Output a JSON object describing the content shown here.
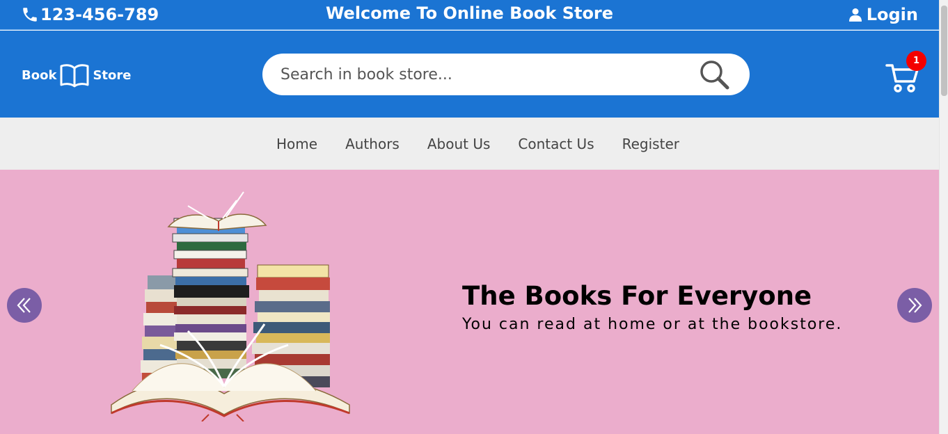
{
  "top_bar": {
    "phone": "123-456-789",
    "welcome": "Welcome To Online Book Store",
    "login": "Login"
  },
  "header": {
    "logo_left": "Book",
    "logo_right": "Store",
    "search_placeholder": "Search in book store...",
    "cart_count": "1"
  },
  "nav": {
    "items": [
      {
        "label": "Home"
      },
      {
        "label": "Authors"
      },
      {
        "label": "About Us"
      },
      {
        "label": "Contact Us"
      },
      {
        "label": "Register"
      }
    ]
  },
  "hero": {
    "title": "The Books For Everyone",
    "subtitle": "You can read at home or at the bookstore."
  },
  "colors": {
    "brand_blue": "#1b74d3",
    "nav_bg": "#eeeeee",
    "hero_bg": "#ebadcc",
    "arrow_bg": "#7b5ea6",
    "badge_red": "#f40000"
  },
  "icons": [
    "phone-icon",
    "user-icon",
    "book-open-icon",
    "search-icon",
    "cart-icon",
    "chevrons-left-icon",
    "chevrons-right-icon"
  ]
}
